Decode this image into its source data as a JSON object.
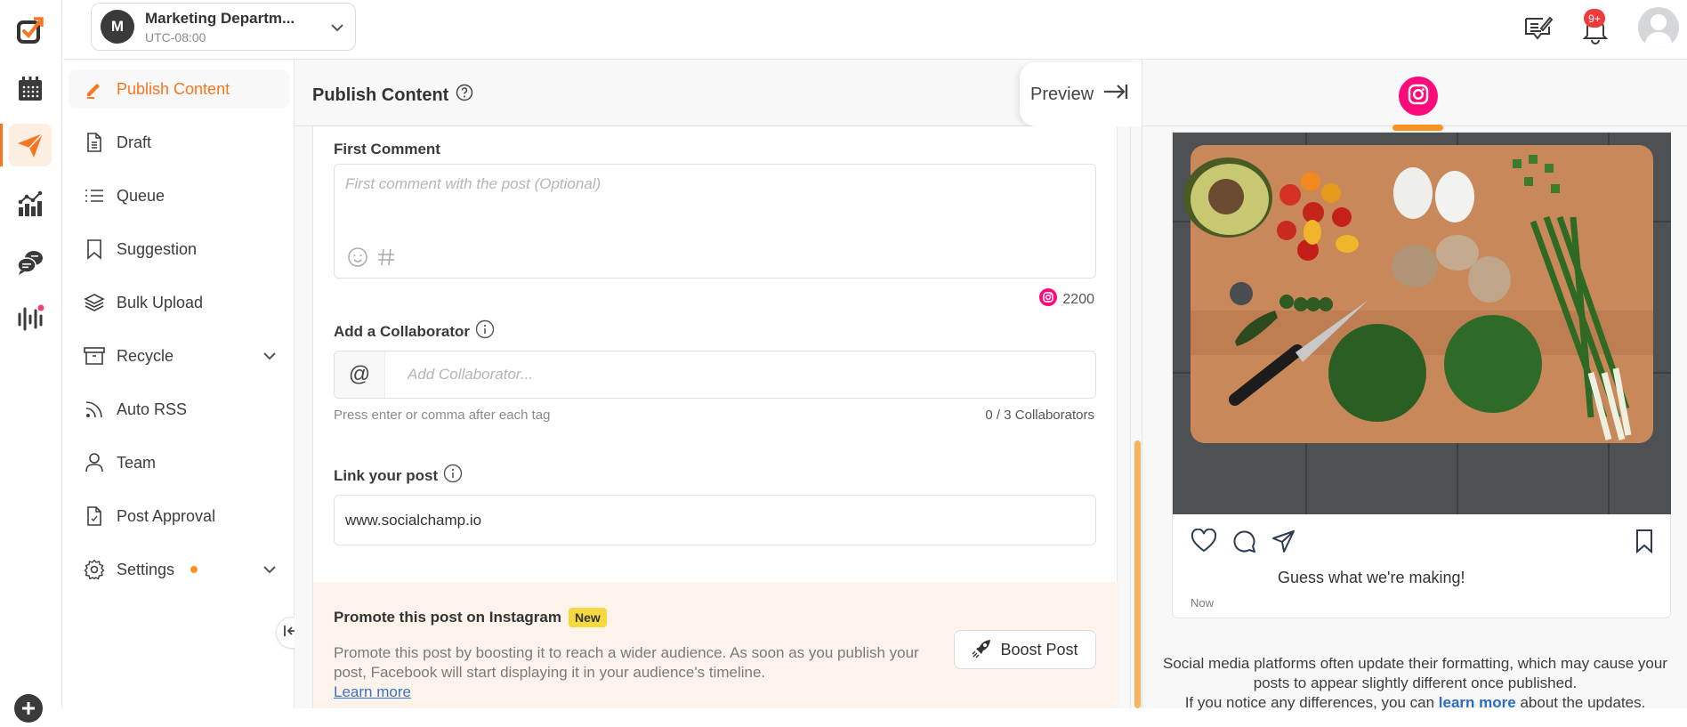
{
  "app": {
    "brand_color": "#f7761f",
    "instagram_color": "#ff0a7b"
  },
  "rail": {
    "items": [
      {
        "name": "logo",
        "icon": "socialchamp-logo-icon"
      },
      {
        "name": "calendar",
        "icon": "calendar-icon"
      },
      {
        "name": "publish",
        "icon": "paper-plane-icon",
        "active": true
      },
      {
        "name": "analytics",
        "icon": "analytics-chart-icon"
      },
      {
        "name": "engagement",
        "icon": "chat-bubbles-icon"
      },
      {
        "name": "listening",
        "icon": "audio-wave-icon",
        "has_dot": true
      }
    ]
  },
  "header": {
    "account": {
      "initial": "M",
      "name": "Marketing Departm...",
      "timezone": "UTC-08:00"
    },
    "notifications_badge": "9+"
  },
  "sidebar": {
    "items": [
      {
        "label": "Publish Content",
        "icon": "pencil-icon",
        "active": true
      },
      {
        "label": "Draft",
        "icon": "document-icon"
      },
      {
        "label": "Queue",
        "icon": "list-icon"
      },
      {
        "label": "Suggestion",
        "icon": "bookmark-icon"
      },
      {
        "label": "Bulk Upload",
        "icon": "layers-icon"
      },
      {
        "label": "Recycle",
        "icon": "archive-box-icon",
        "expandable": true
      },
      {
        "label": "Auto RSS",
        "icon": "rss-icon"
      },
      {
        "label": "Team",
        "icon": "user-icon"
      },
      {
        "label": "Post Approval",
        "icon": "document-check-icon"
      },
      {
        "label": "Settings",
        "icon": "gear-icon",
        "expandable": true,
        "has_dot": true
      }
    ]
  },
  "content": {
    "title": "Publish Content",
    "preview_label": "Preview",
    "first_comment": {
      "label": "First Comment",
      "placeholder": "First comment with the post (Optional)",
      "value": "",
      "char_count": "2200"
    },
    "collaborator": {
      "label": "Add a Collaborator",
      "at_symbol": "@",
      "placeholder": "Add Collaborator...",
      "hint": "Press enter or comma after each tag",
      "count": "0 / 3 Collaborators"
    },
    "link": {
      "label": "Link your post",
      "value": "www.socialchamp.io"
    },
    "promote": {
      "title": "Promote this post on Instagram",
      "badge": "New",
      "description": "Promote this post by boosting it to reach a wider audience. As soon as you publish your post, Facebook will start displaying it in your audience's timeline.",
      "learn_more": "Learn more",
      "boost_label": "Boost Post"
    },
    "scroll_position": 0.55
  },
  "preview": {
    "active_network": "Instagram",
    "caption": "Guess what we're making!",
    "time": "Now",
    "notice_line1": "Social media platforms often update their formatting, which may cause your posts to appear slightly different once published.",
    "notice_prefix": "If you notice any differences, you can ",
    "notice_link": "learn more",
    "notice_suffix": " about the updates."
  }
}
